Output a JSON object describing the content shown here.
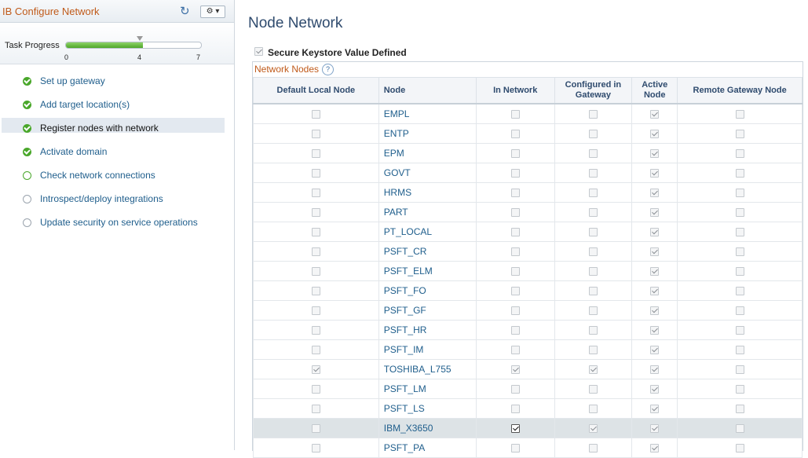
{
  "panel": {
    "title": "IB Configure Network",
    "refresh_icon": "refresh-icon",
    "gear_icon": "gear-icon"
  },
  "progress": {
    "label": "Task Progress",
    "min": "0",
    "current": "4",
    "max": "7",
    "fraction": 0.571
  },
  "steps": [
    {
      "label": "Set up gateway",
      "status": "done"
    },
    {
      "label": "Add target location(s)",
      "status": "done"
    },
    {
      "label": "Register nodes with network",
      "status": "done",
      "active": true
    },
    {
      "label": "Activate domain",
      "status": "done"
    },
    {
      "label": "Check network connections",
      "status": "current"
    },
    {
      "label": "Introspect/deploy integrations",
      "status": "todo"
    },
    {
      "label": "Update security on service operations",
      "status": "todo"
    }
  ],
  "main": {
    "title": "Node Network",
    "keystore_label": "Secure Keystore Value Defined",
    "keystore_checked": true,
    "grid_caption": "Network Nodes",
    "help_icon": "?",
    "headers": [
      "Default Local Node",
      "Node",
      "In Network",
      "Configured in Gateway",
      "Active Node",
      "Remote Gateway Node"
    ],
    "rows": [
      {
        "node": "EMPL",
        "default": false,
        "in_network": false,
        "configured": false,
        "active": true,
        "remote": false
      },
      {
        "node": "ENTP",
        "default": false,
        "in_network": false,
        "configured": false,
        "active": true,
        "remote": false
      },
      {
        "node": "EPM",
        "default": false,
        "in_network": false,
        "configured": false,
        "active": true,
        "remote": false
      },
      {
        "node": "GOVT",
        "default": false,
        "in_network": false,
        "configured": false,
        "active": true,
        "remote": false
      },
      {
        "node": "HRMS",
        "default": false,
        "in_network": false,
        "configured": false,
        "active": true,
        "remote": false
      },
      {
        "node": "PART",
        "default": false,
        "in_network": false,
        "configured": false,
        "active": true,
        "remote": false
      },
      {
        "node": "PT_LOCAL",
        "default": false,
        "in_network": false,
        "configured": false,
        "active": true,
        "remote": false
      },
      {
        "node": "PSFT_CR",
        "default": false,
        "in_network": false,
        "configured": false,
        "active": true,
        "remote": false
      },
      {
        "node": "PSFT_ELM",
        "default": false,
        "in_network": false,
        "configured": false,
        "active": true,
        "remote": false
      },
      {
        "node": "PSFT_FO",
        "default": false,
        "in_network": false,
        "configured": false,
        "active": true,
        "remote": false
      },
      {
        "node": "PSFT_GF",
        "default": false,
        "in_network": false,
        "configured": false,
        "active": true,
        "remote": false
      },
      {
        "node": "PSFT_HR",
        "default": false,
        "in_network": false,
        "configured": false,
        "active": true,
        "remote": false
      },
      {
        "node": "PSFT_IM",
        "default": false,
        "in_network": false,
        "configured": false,
        "active": true,
        "remote": false
      },
      {
        "node": "TOSHIBA_L755",
        "default": true,
        "in_network": true,
        "configured": true,
        "active": true,
        "remote": false
      },
      {
        "node": "PSFT_LM",
        "default": false,
        "in_network": false,
        "configured": false,
        "active": true,
        "remote": false
      },
      {
        "node": "PSFT_LS",
        "default": false,
        "in_network": false,
        "configured": false,
        "active": true,
        "remote": false
      },
      {
        "node": "IBM_X3650",
        "default": false,
        "in_network": true,
        "configured": true,
        "active": true,
        "remote": false,
        "selected": true,
        "in_network_editable": true
      },
      {
        "node": "PSFT_PA",
        "default": false,
        "in_network": false,
        "configured": false,
        "active": true,
        "remote": false
      }
    ]
  },
  "colors": {
    "accent_orange": "#c05a1a",
    "link_blue": "#1f5e8c",
    "success_green": "#49a72a",
    "selected_row": "#dde3e6"
  }
}
